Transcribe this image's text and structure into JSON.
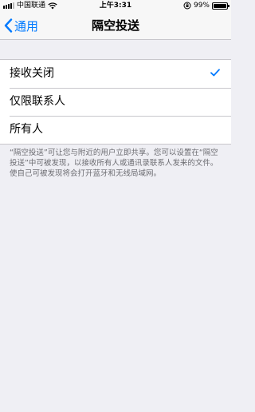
{
  "status_bar": {
    "carrier": "中国联通",
    "time": "上午3:31",
    "battery_percent": "99%",
    "battery_level": 0.99
  },
  "nav": {
    "back_label": "通用",
    "title": "隔空投送"
  },
  "options": [
    {
      "label": "接收关闭",
      "selected": true
    },
    {
      "label": "仅限联系人",
      "selected": false
    },
    {
      "label": "所有人",
      "selected": false
    }
  ],
  "footer_note": "“隔空投送”可让您与附近的用户立即共享。您可以设置在“隔空投送”中可被发现，以接收所有人或通讯录联系人发来的文件。使自己可被发现将会打开蓝牙和无线局域网。",
  "colors": {
    "accent": "#007aff",
    "background": "#efeff4"
  }
}
